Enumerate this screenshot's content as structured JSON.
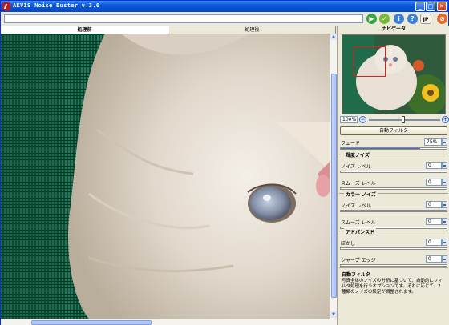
{
  "window": {
    "title": "AKVIS Noise Buster v.3.0"
  },
  "toolbar": {
    "address_value": "",
    "lang_label": "JP"
  },
  "tabs": {
    "before": "処理前",
    "after": "処理後"
  },
  "navigator": {
    "title": "ナビゲータ",
    "zoom_value": "100%"
  },
  "settings": {
    "auto_filter_label": "自動フィルタ",
    "fade_label": "フェード",
    "fade_value": "75%",
    "fade_fraction": 0.75,
    "luminance_noise": {
      "title": "輝度ノイズ",
      "noise_level_label": "ノイズ レベル",
      "noise_level_value": "0",
      "smooth_level_label": "スムーズ レベル",
      "smooth_level_value": "0"
    },
    "color_noise": {
      "title": "カラー ノイズ",
      "noise_level_label": "ノイズ レベル",
      "noise_level_value": "0",
      "smooth_level_label": "スムーズ レベル",
      "smooth_level_value": "0"
    },
    "advanced": {
      "title": "アドバンスド",
      "blur_label": "ぼかし",
      "blur_value": "0",
      "sharpen_label": "シャープ エッジ",
      "sharpen_value": "0"
    }
  },
  "help": {
    "title": "自動フィルタ",
    "text": "写真全体のノイズの分析に基づいて、自動的にフィルタ処理を行うオプションです。それに応じて、2 種類のノイズの設定が調整されます。"
  },
  "icons": {
    "run": "run-icon",
    "apply": "apply-icon",
    "info": "info-icon",
    "help": "help-icon",
    "stop": "stop-icon"
  }
}
